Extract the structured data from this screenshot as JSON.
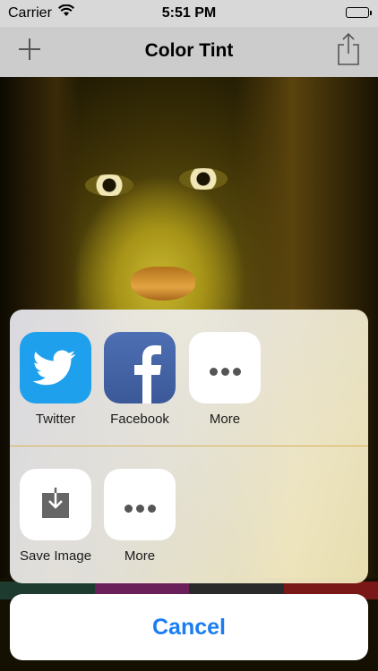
{
  "status_bar": {
    "carrier": "Carrier",
    "time": "5:51 PM"
  },
  "navbar": {
    "title": "Color Tint",
    "left_icon": "plus-icon",
    "right_icon": "share-icon"
  },
  "share_sheet": {
    "app_row": [
      {
        "label": "Twitter",
        "icon": "twitter-icon"
      },
      {
        "label": "Facebook",
        "icon": "facebook-icon"
      },
      {
        "label": "More",
        "icon": "more-icon"
      }
    ],
    "action_row": [
      {
        "label": "Save Image",
        "icon": "save-image-icon"
      },
      {
        "label": "More",
        "icon": "more-icon"
      }
    ]
  },
  "cancel_label": "Cancel",
  "colors": {
    "accent": "#1a7ef2",
    "twitter": "#1fa0ec",
    "facebook": "#3b5998",
    "divider": "#d8b35a"
  }
}
